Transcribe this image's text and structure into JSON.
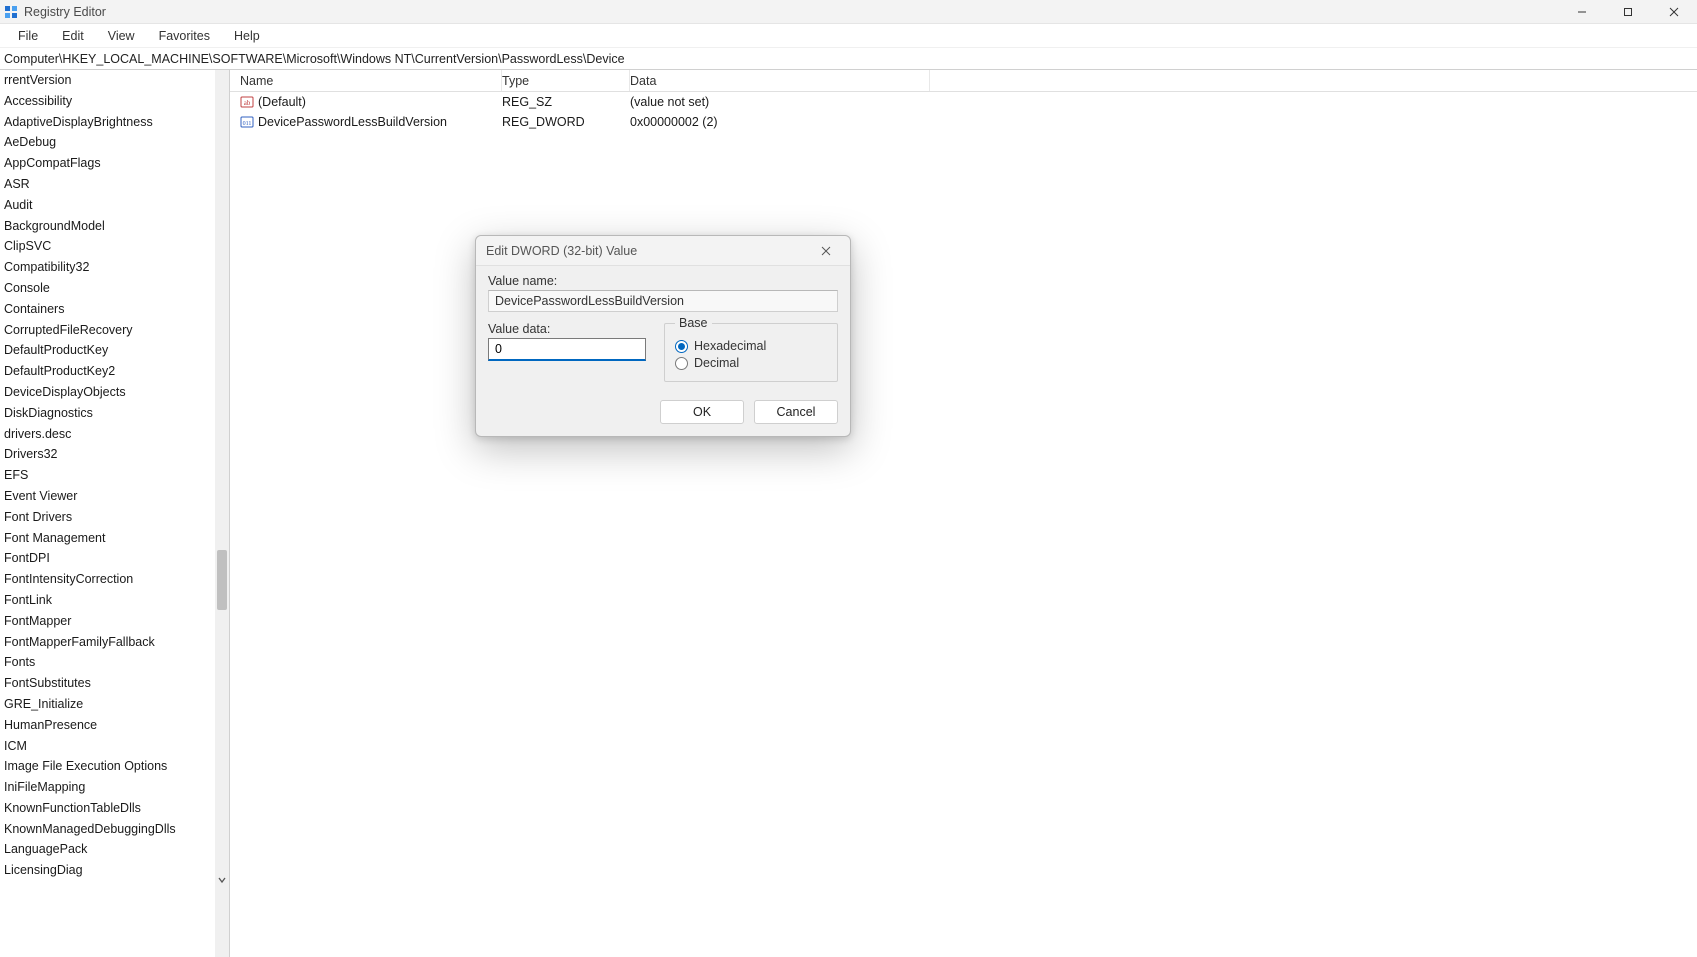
{
  "titlebar": {
    "app_title": "Registry Editor"
  },
  "menubar": {
    "items": [
      "File",
      "Edit",
      "View",
      "Favorites",
      "Help"
    ]
  },
  "addressbar": {
    "path": "Computer\\HKEY_LOCAL_MACHINE\\SOFTWARE\\Microsoft\\Windows NT\\CurrentVersion\\PasswordLess\\Device"
  },
  "tree": {
    "items": [
      "rrentVersion",
      "Accessibility",
      "AdaptiveDisplayBrightness",
      "AeDebug",
      "AppCompatFlags",
      "ASR",
      "Audit",
      "BackgroundModel",
      "ClipSVC",
      "Compatibility32",
      "Console",
      "Containers",
      "CorruptedFileRecovery",
      "DefaultProductKey",
      "DefaultProductKey2",
      "DeviceDisplayObjects",
      "DiskDiagnostics",
      "drivers.desc",
      "Drivers32",
      "EFS",
      "Event Viewer",
      "Font Drivers",
      "Font Management",
      "FontDPI",
      "FontIntensityCorrection",
      "FontLink",
      "FontMapper",
      "FontMapperFamilyFallback",
      "Fonts",
      "FontSubstitutes",
      "GRE_Initialize",
      "HumanPresence",
      "ICM",
      "Image File Execution Options",
      "IniFileMapping",
      "KnownFunctionTableDlls",
      "KnownManagedDebuggingDlls",
      "LanguagePack",
      "LicensingDiag"
    ]
  },
  "list": {
    "columns": {
      "name": "Name",
      "type": "Type",
      "data": "Data"
    },
    "rows": [
      {
        "icon": "string",
        "name": "(Default)",
        "type": "REG_SZ",
        "data": "(value not set)"
      },
      {
        "icon": "binary",
        "name": "DevicePasswordLessBuildVersion",
        "type": "REG_DWORD",
        "data": "0x00000002 (2)"
      }
    ]
  },
  "dialog": {
    "title": "Edit DWORD (32-bit) Value",
    "value_name_label": "Value name:",
    "value_name": "DevicePasswordLessBuildVersion",
    "value_data_label": "Value data:",
    "value_data": "0",
    "base_label": "Base",
    "base_hex": "Hexadecimal",
    "base_dec": "Decimal",
    "ok": "OK",
    "cancel": "Cancel"
  }
}
